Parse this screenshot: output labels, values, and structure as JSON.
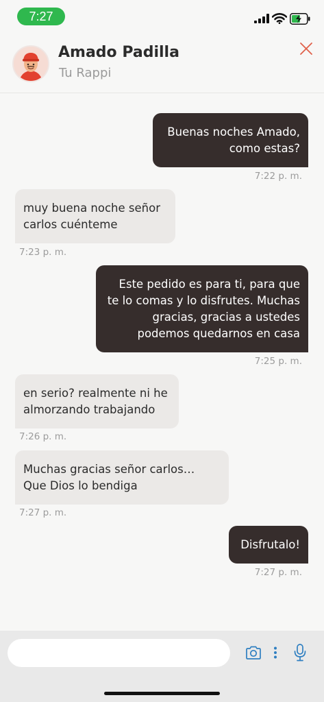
{
  "status_bar": {
    "time": "7:27"
  },
  "header": {
    "name": "Amado Padilla",
    "subtitle": "Tu Rappi"
  },
  "messages": [
    {
      "direction": "out",
      "text": "Buenas noches Amado, como estas?",
      "time": "7:22 p. m."
    },
    {
      "direction": "in",
      "text": "muy buena noche señor carlos cuénteme",
      "time": "7:23 p. m."
    },
    {
      "direction": "out",
      "text": "Este pedido es para ti, para que te lo comas y lo disfrutes. Muchas gracias, gracias a ustedes podemos quedarnos en casa",
      "time": "7:25 p. m."
    },
    {
      "direction": "in",
      "text": "en serio? realmente ni he almorzando trabajando",
      "time": "7:26 p. m."
    },
    {
      "direction": "in",
      "text": "Muchas gracias señor carlos… Que Dios lo bendiga",
      "time": "7:27 p. m."
    },
    {
      "direction": "out",
      "text": "Disfrutalo!",
      "time": "7:27 p. m."
    }
  ],
  "composer": {
    "placeholder": ""
  },
  "colors": {
    "status_green": "#2fb84e",
    "outgoing_bubble": "#362d2c",
    "incoming_bubble": "#ebe9e7",
    "icon_blue": "#2f7fc1",
    "close_red": "#e0604a"
  },
  "icons": {
    "close": "close-icon",
    "camera": "camera-icon",
    "more": "more-vertical-icon",
    "mic": "microphone-icon"
  }
}
